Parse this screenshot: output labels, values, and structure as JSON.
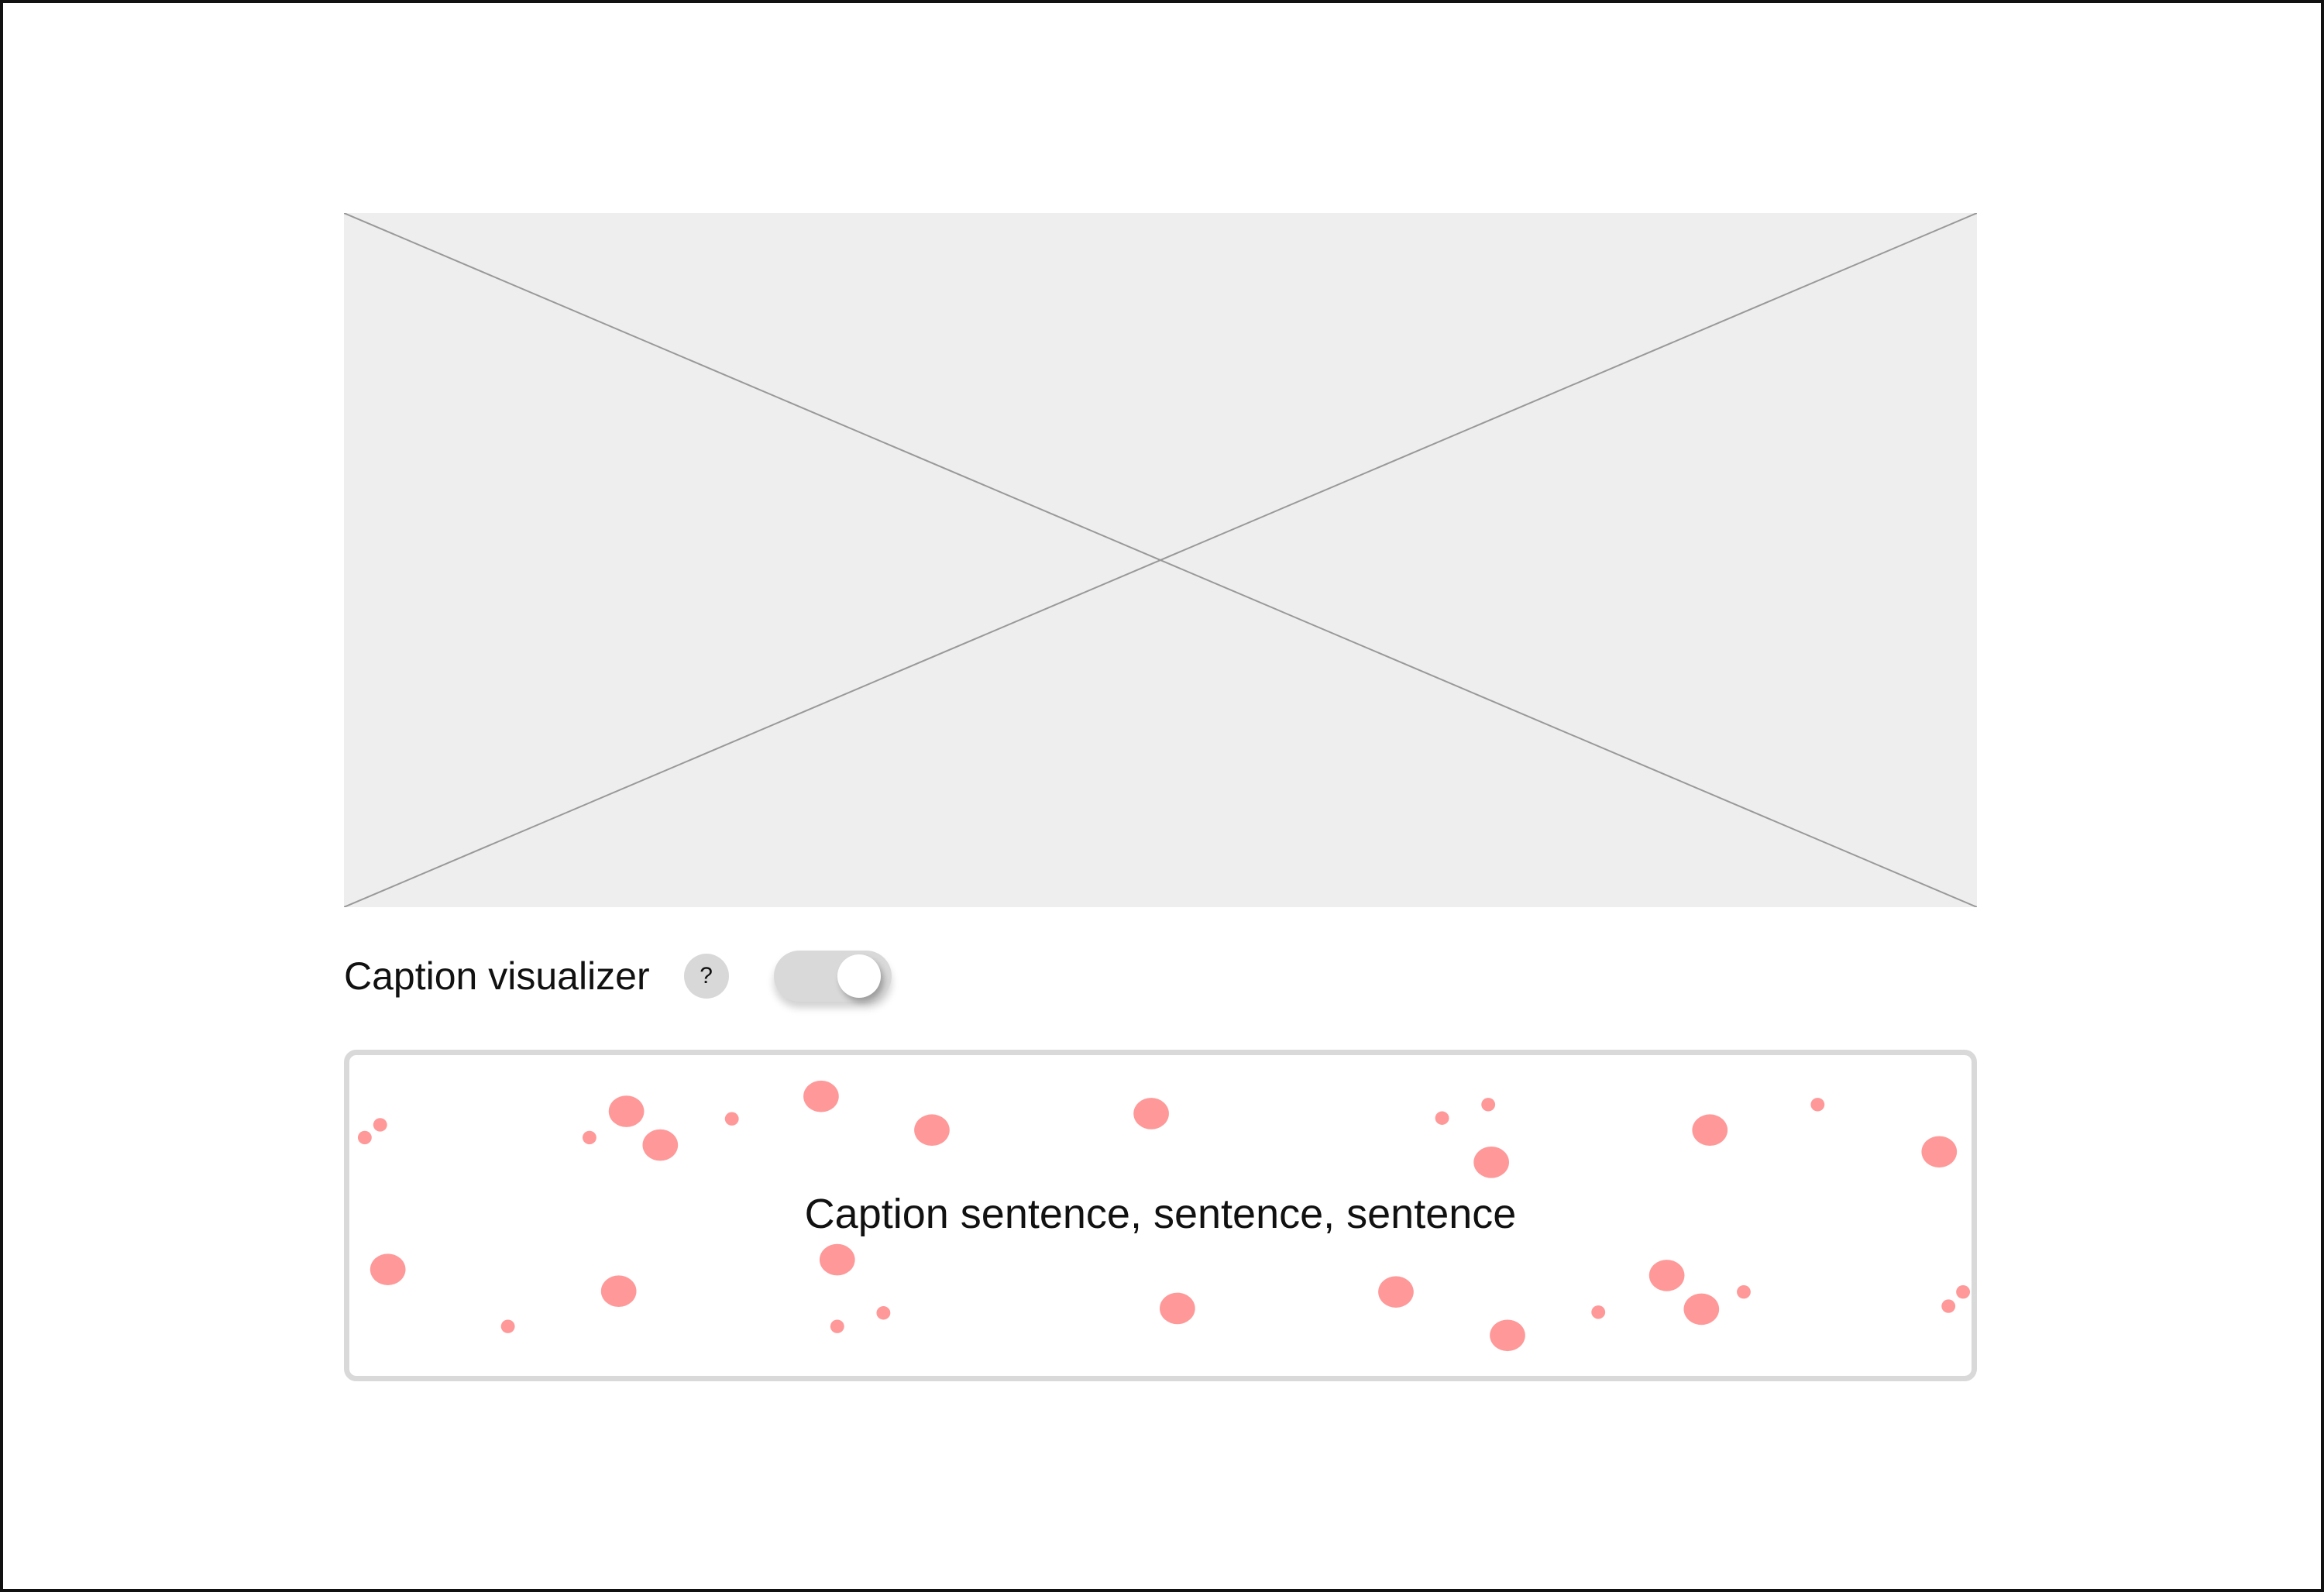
{
  "controls": {
    "caption_visualizer_label": "Caption visualizer",
    "help_icon_glyph": "?",
    "toggle_state": "on"
  },
  "visualizer": {
    "caption_text": "Caption sentence, sentence, sentence",
    "dot_color": "#ff9999"
  },
  "colors": {
    "placeholder_fill": "#eeeeee",
    "placeholder_lines": "#999999",
    "toggle_track": "#d9d9d9",
    "visualizer_border": "#d9d9d9"
  },
  "icons": {
    "help": "question-mark-icon",
    "image_placeholder": "image-placeholder-icon"
  }
}
